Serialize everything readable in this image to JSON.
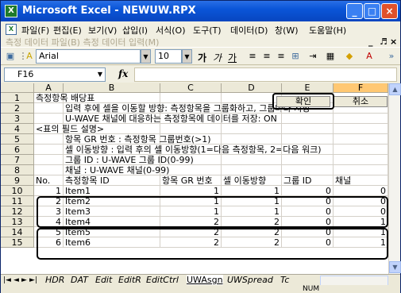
{
  "window": {
    "title": "Microsoft Excel - NEWUW.RPX",
    "app_icon": "X",
    "controls": {
      "minimize": "_",
      "maximize": "□",
      "close": "×"
    }
  },
  "menu": {
    "items": [
      "파일(F)",
      "편집(E)",
      "보기(V)",
      "삽입(I)",
      "서식(O)",
      "도구(T)",
      "데이터(D)",
      "창(W)",
      "도움말(H)"
    ],
    "sub_items": "측정 데이터 파일(B)   측정 데이터 입력(M)",
    "doc_minimize": "_",
    "doc_restore": "♬",
    "doc_close": "×"
  },
  "toolbar": {
    "font": "Arial",
    "size": "10",
    "bold": "가",
    "italic": "가",
    "underline": "가"
  },
  "formula_bar": {
    "name_box": "F16",
    "fx": "fx",
    "formula": ""
  },
  "columns": [
    "A",
    "B",
    "C",
    "D",
    "E",
    "F"
  ],
  "rows": [
    {
      "n": "1",
      "a": "측정항목 배당표",
      "confirm": "확인",
      "cancel": "취소"
    },
    {
      "n": "2",
      "b": "입력 후에 셀을 이동할 방향: 측정항목을 그룹화하고, 그룹마다 지정"
    },
    {
      "n": "3",
      "b": "U-WAVE 채널에 대응하는 측정항목에 데이터를 저장: ON"
    },
    {
      "n": "4",
      "a": "<표의 필드 설명>"
    },
    {
      "n": "5",
      "b": "항목 GR 번호 : 측정항목 그룹번호(>1)"
    },
    {
      "n": "6",
      "b": "셀 이동방향 : 입력 후의 셀 이동방향(1=다음 측정항목, 2=다음 워크)"
    },
    {
      "n": "7",
      "b": "그룹 ID : U-WAVE 그룹 ID(0-99)"
    },
    {
      "n": "8",
      "b": "채널 : U-WAVE 채널(0-99)"
    },
    {
      "n": "9",
      "a": "No.",
      "b": "측정항목 ID",
      "c": "항목 GR 번호",
      "d": "셀 이동방향",
      "e": "그룹 ID",
      "f": "채널"
    },
    {
      "n": "10",
      "a": "1",
      "b": "Item1",
      "c": "1",
      "d": "1",
      "e": "0",
      "f": "0"
    },
    {
      "n": "11",
      "a": "2",
      "b": "Item2",
      "c": "1",
      "d": "1",
      "e": "0",
      "f": "0"
    },
    {
      "n": "12",
      "a": "3",
      "b": "Item3",
      "c": "1",
      "d": "1",
      "e": "0",
      "f": "0"
    },
    {
      "n": "13",
      "a": "4",
      "b": "Item4",
      "c": "2",
      "d": "2",
      "e": "0",
      "f": "1"
    },
    {
      "n": "14",
      "a": "5",
      "b": "Item5",
      "c": "2",
      "d": "2",
      "e": "0",
      "f": "1"
    },
    {
      "n": "15",
      "a": "6",
      "b": "Item6",
      "c": "2",
      "d": "2",
      "e": "0",
      "f": "1"
    }
  ],
  "sheet_tabs": {
    "nav": [
      "|◄",
      "◄",
      "►",
      "►|"
    ],
    "tabs": [
      "HDR",
      "DAT",
      "Edit",
      "EditR",
      "EditCtrl",
      "UWAsgn",
      "UWSpread",
      "Tc"
    ],
    "active": "UWAsgn"
  },
  "status": {
    "num": "NUM"
  },
  "colors": {
    "title_blue": "#0a55d8",
    "selected_col": "#ffc873",
    "close_red": "#e0512b"
  }
}
